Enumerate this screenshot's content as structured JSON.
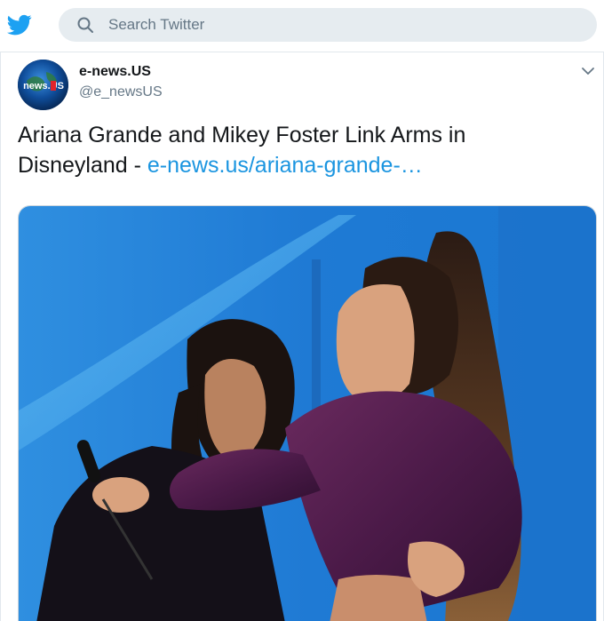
{
  "header": {
    "logo_icon": "twitter-bird-icon",
    "search": {
      "placeholder": "Search Twitter",
      "icon": "search-icon"
    }
  },
  "tweet": {
    "author": {
      "name": "e-news.US",
      "handle": "@e_newsUS",
      "avatar_text": "news.US"
    },
    "menu_icon": "chevron-down-icon",
    "text": "Ariana Grande and Mikey Foster Link Arms in Disneyland - ",
    "link": "e-news.us/ariana-grande-…",
    "media_icon": "photo-concert-image"
  },
  "colors": {
    "brand": "#1da1f2",
    "link": "#1b95e0",
    "search_bg": "#e6ecf0",
    "muted": "#657786"
  }
}
